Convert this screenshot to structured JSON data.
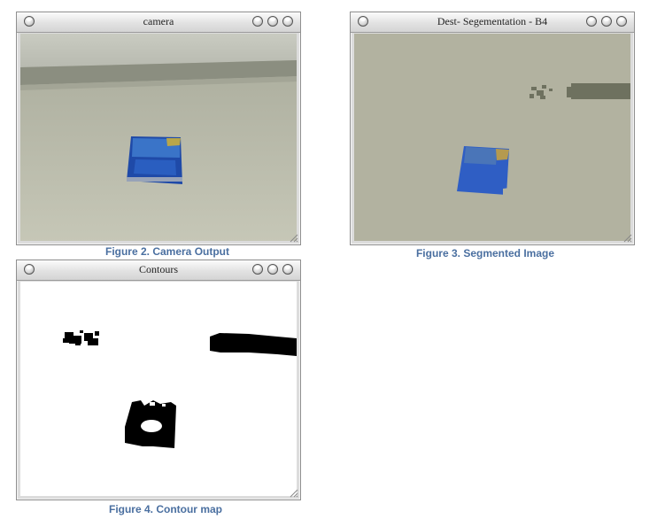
{
  "windows": [
    {
      "id": "camera",
      "title": "camera",
      "caption": "Figure 2. Camera Output"
    },
    {
      "id": "segmentation",
      "title": "Dest- Segementation - B4",
      "caption": "Figure 3. Segmented Image"
    },
    {
      "id": "contours",
      "title": "Contours",
      "caption": "Figure 4. Contour map"
    }
  ],
  "colors": {
    "caption": "#4a6fa0",
    "camera_floor": "#b9baa9",
    "camera_wall": "#8c8f82",
    "segmented_bg": "#b2b2a0",
    "segmented_object": "#2e5cc4",
    "contour_bg": "#ffffff",
    "contour_fill": "#000000"
  }
}
